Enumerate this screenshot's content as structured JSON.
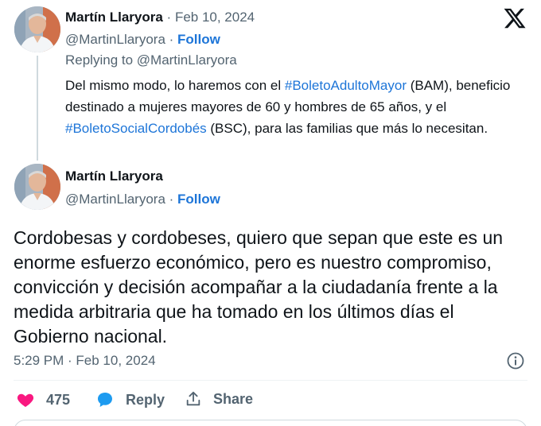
{
  "colors": {
    "accent": "#1d75d8",
    "like": "#f91880",
    "text": "#0f1419",
    "muted": "#536471"
  },
  "brand_icon": "x-logo-icon",
  "parent_tweet": {
    "author_name": "Martín Llaryora",
    "date": "Feb 10, 2024",
    "handle": "@MartinLlaryora",
    "follow_label": "Follow",
    "replying_to": "Replying to @MartinLlaryora",
    "text_1": "Del mismo modo, lo haremos con el ",
    "hashtag_1": "#BoletoAdultoMayor",
    "text_2": " (BAM), beneficio destinado a mujeres mayores de 60 y hombres de 65 años, y el ",
    "hashtag_2": "#BoletoSocialCordobés",
    "text_3": " (BSC), para las familias que más lo necesitan."
  },
  "main_tweet": {
    "author_name": "Martín Llaryora",
    "handle": "@MartinLlaryora",
    "follow_label": "Follow",
    "text": "Cordobesas y cordobeses, quiero que sepan que este es un enorme esfuerzo económico, pero es nuestro compromiso, convicción y decisión acompañar a la ciudadanía frente a la medida arbitraria que ha tomado en los últimos días el Gobierno nacional.",
    "timestamp": "5:29 PM · Feb 10, 2024"
  },
  "actions": {
    "like_count": "475",
    "reply_label": "Reply",
    "share_label": "Share"
  }
}
